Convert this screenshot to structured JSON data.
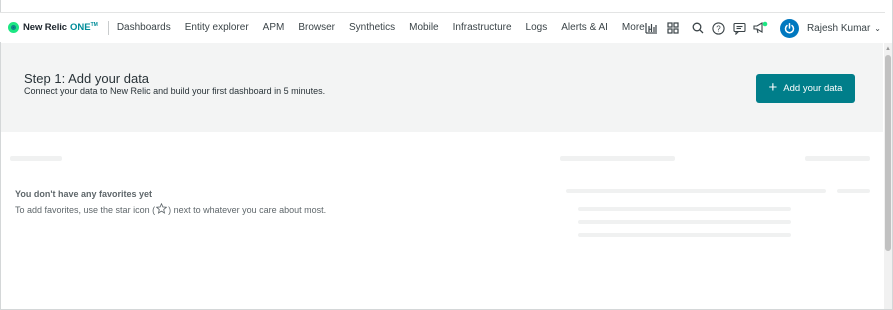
{
  "brand": {
    "name": "New Relic",
    "one": "ONE",
    "tm": "TM"
  },
  "nav": {
    "items": [
      "Dashboards",
      "Entity explorer",
      "APM",
      "Browser",
      "Synthetics",
      "Mobile",
      "Infrastructure",
      "Logs",
      "Alerts & AI"
    ],
    "more_label": "More",
    "user_name": "Rajesh Kumar",
    "icons": [
      "chart-bars-icon",
      "apps-grid-icon",
      "search-icon",
      "help-icon",
      "feedback-icon",
      "whats-new-icon",
      "user-avatar-icon"
    ]
  },
  "banner": {
    "title": "Step 1: Add your data",
    "subtitle": "Connect your data to New Relic and build your first dashboard in 5 minutes.",
    "button_label": "Add your data",
    "button_color": "#007e8a"
  },
  "favorites": {
    "title": "You don't have any favorites yet",
    "desc_before": "To add favorites, use the star icon (",
    "desc_after": ") next to whatever you care about most."
  },
  "colors": {
    "accent": "#007e8a",
    "avatar": "#0078bf",
    "logo_green": "#1ce783"
  }
}
